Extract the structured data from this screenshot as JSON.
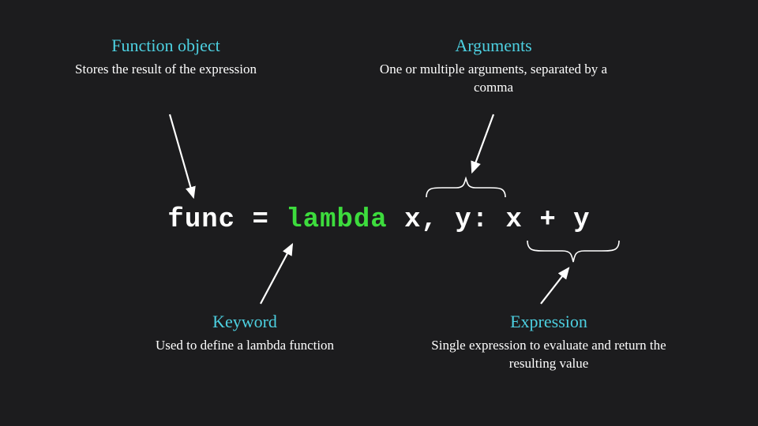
{
  "function_object": {
    "title": "Function object",
    "desc": "Stores the result of the expression"
  },
  "arguments": {
    "title": "Arguments",
    "desc": "One or multiple arguments, separated by a comma"
  },
  "keyword": {
    "title": "Keyword",
    "desc": "Used to define a lambda function"
  },
  "expression": {
    "title": "Expression",
    "desc": "Single expression to evaluate and return the resulting value"
  },
  "code": {
    "func": "func",
    "eq": " = ",
    "lambda": "lambda",
    "sp": " ",
    "args": "x, y",
    "colon": ": ",
    "expr": "x + y"
  }
}
